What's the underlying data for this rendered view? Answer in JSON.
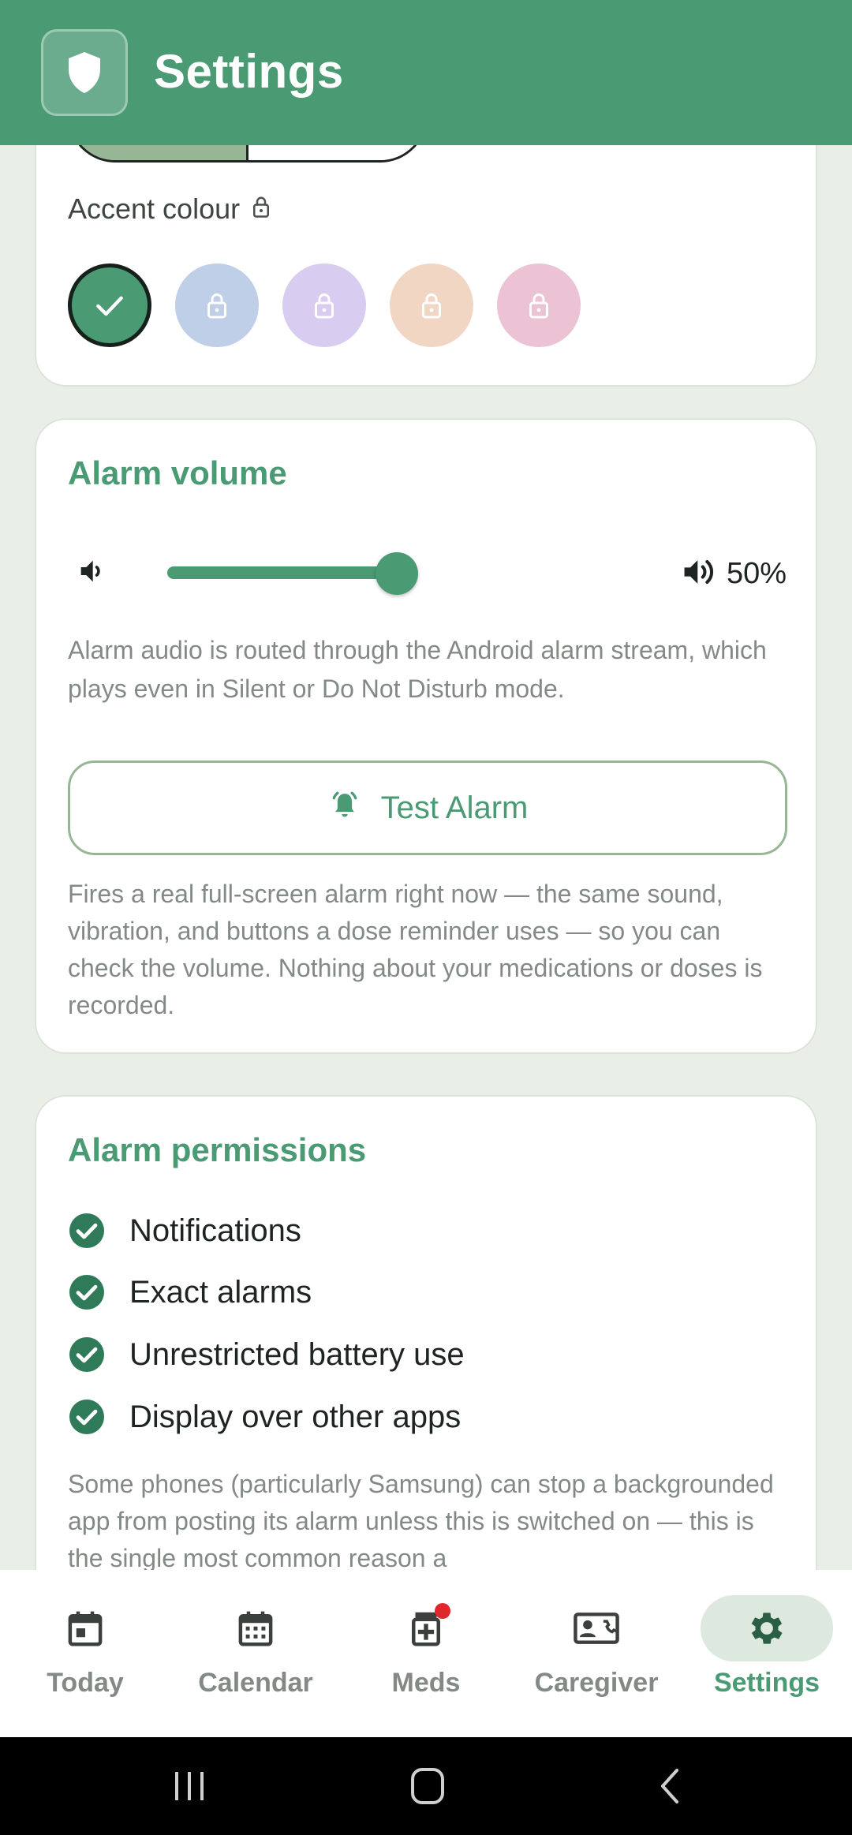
{
  "appbar": {
    "title": "Settings",
    "icon": "shield-icon"
  },
  "theme": {
    "accent_label": "Accent colour",
    "swatches": [
      {
        "color": "#4a9a74",
        "selected": true,
        "locked": false
      },
      {
        "color": "#bfcfe8",
        "selected": false,
        "locked": true
      },
      {
        "color": "#d8cdf0",
        "selected": false,
        "locked": true
      },
      {
        "color": "#f2d6c4",
        "selected": false,
        "locked": true
      },
      {
        "color": "#ecc3d4",
        "selected": false,
        "locked": true
      }
    ]
  },
  "alarm_volume": {
    "title": "Alarm volume",
    "level": 0.5,
    "percent_label": "50%",
    "description": "Alarm audio is routed through the Android alarm stream, which plays even in Silent or Do Not Disturb mode.",
    "test_button": "Test Alarm",
    "test_description": "Fires a real full-screen alarm right now — the same sound, vibration, and buttons a dose reminder uses — so you can check the volume. Nothing about your medications or doses is recorded."
  },
  "permissions": {
    "title": "Alarm permissions",
    "items": [
      {
        "label": "Notifications",
        "granted": true
      },
      {
        "label": "Exact alarms",
        "granted": true
      },
      {
        "label": "Unrestricted battery use",
        "granted": true
      },
      {
        "label": "Display over other apps",
        "granted": true
      }
    ],
    "note": "Some phones (particularly Samsung) can stop a backgrounded app from posting its alarm unless this is switched on — this is the single most common reason a"
  },
  "bottom_nav": {
    "items": [
      {
        "label": "Today",
        "icon": "calendar-today-icon",
        "active": false
      },
      {
        "label": "Calendar",
        "icon": "calendar-month-icon",
        "active": false
      },
      {
        "label": "Meds",
        "icon": "medication-icon",
        "active": false,
        "badge": true
      },
      {
        "label": "Caregiver",
        "icon": "contact-phone-icon",
        "active": false
      },
      {
        "label": "Settings",
        "icon": "gear-icon",
        "active": true
      }
    ]
  },
  "colors": {
    "primary": "#4a9a74",
    "badge": "#e0272e"
  }
}
